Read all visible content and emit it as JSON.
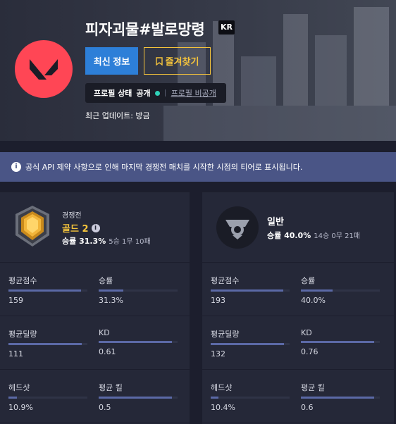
{
  "header": {
    "name": "피자괴물#발로망령",
    "region": "KR",
    "update_button": "최신 정보",
    "favorite_button": "즐겨찾기",
    "profile_status_label": "프로필 상태",
    "profile_status_value": "공개",
    "profile_private_link": "프로필 비공개",
    "last_updated": "최근 업데이트: 방금",
    "brand_color": "#ff4655"
  },
  "notice": {
    "text": "공식 API 제약 사항으로 인해 마지막 경쟁전 매치를 시작한 시점의 티어로 표시됩니다."
  },
  "competitive": {
    "queue": "경쟁전",
    "tier": "골드 2",
    "winrate_label": "승률 31.3%",
    "record": "5승 1무 10패",
    "stats": [
      {
        "label": "평균점수",
        "value": "159",
        "bar": 0.92
      },
      {
        "label": "승률",
        "value": "31.3%",
        "bar": 0.31
      },
      {
        "label": "평균딜량",
        "value": "111",
        "bar": 0.93
      },
      {
        "label": "KD",
        "value": "0.61",
        "bar": 0.93
      },
      {
        "label": "헤드샷",
        "value": "10.9%",
        "bar": 0.11
      },
      {
        "label": "평균 킬",
        "value": "0.5",
        "bar": 0.93
      }
    ]
  },
  "general": {
    "queue": "일반",
    "winrate_label": "승률 40.0%",
    "record": "14승 0무 21패",
    "stats": [
      {
        "label": "평균점수",
        "value": "193",
        "bar": 0.92
      },
      {
        "label": "승률",
        "value": "40.0%",
        "bar": 0.4
      },
      {
        "label": "평균딜량",
        "value": "132",
        "bar": 0.93
      },
      {
        "label": "KD",
        "value": "0.76",
        "bar": 0.93
      },
      {
        "label": "헤드샷",
        "value": "10.4%",
        "bar": 0.1
      },
      {
        "label": "평균 킬",
        "value": "0.6",
        "bar": 0.93
      }
    ]
  }
}
